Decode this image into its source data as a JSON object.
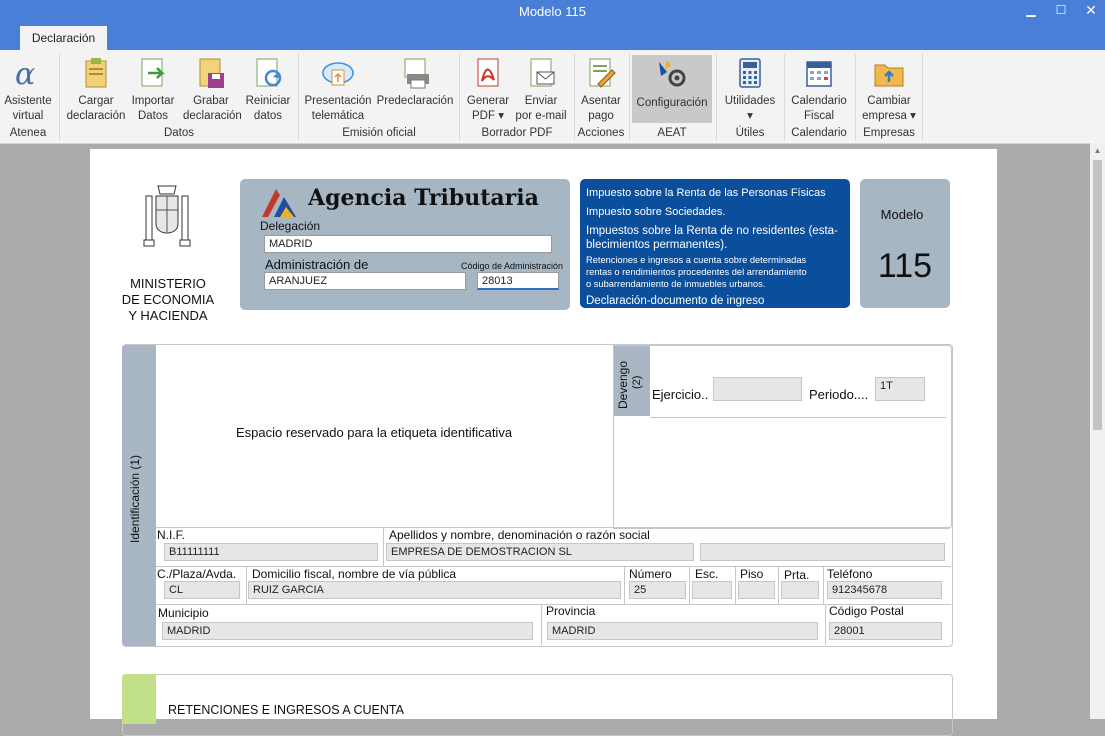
{
  "window": {
    "title": "Modelo 115",
    "min_icon": "minimize-icon",
    "max_icon": "maximize-icon",
    "close_icon": "close-icon"
  },
  "ribbon": {
    "tab": "Declaración",
    "buttons": [
      {
        "id": "asistente",
        "l1": "Asistente",
        "l2": "virtual",
        "icon": "alpha-icon"
      },
      {
        "id": "cargar",
        "l1": "Cargar",
        "l2": "declaración",
        "icon": "clipboard-icon"
      },
      {
        "id": "importar",
        "l1": "Importar",
        "l2": "Datos",
        "icon": "import-icon"
      },
      {
        "id": "grabar",
        "l1": "Grabar",
        "l2": "declaración",
        "icon": "save-icon"
      },
      {
        "id": "reiniciar",
        "l1": "Reiniciar",
        "l2": "datos",
        "icon": "refresh-icon"
      },
      {
        "id": "presentacion",
        "l1": "Presentación",
        "l2": "telemática",
        "icon": "cloud-upload-icon"
      },
      {
        "id": "prede",
        "l1": "Predeclaración",
        "l2": "",
        "icon": "printer-icon"
      },
      {
        "id": "pdf",
        "l1": "Generar",
        "l2": "PDF ▾",
        "icon": "pdf-icon"
      },
      {
        "id": "email",
        "l1": "Enviar",
        "l2": "por e-mail",
        "icon": "email-icon"
      },
      {
        "id": "asentar",
        "l1": "Asentar",
        "l2": "pago",
        "icon": "pencil-doc-icon"
      },
      {
        "id": "config",
        "l1": "Configuración",
        "l2": "",
        "icon": "gear-icon"
      },
      {
        "id": "utiles",
        "l1": "Utilidades",
        "l2": "▾",
        "icon": "calculator-icon"
      },
      {
        "id": "calendario",
        "l1": "Calendario",
        "l2": "Fiscal",
        "icon": "calendar-icon"
      },
      {
        "id": "empresa",
        "l1": "Cambiar",
        "l2": "empresa ▾",
        "icon": "folder-icon"
      }
    ],
    "groups": [
      "Atenea",
      "Datos",
      "Emisión oficial",
      "Borrador PDF",
      "Acciones",
      "AEAT",
      "Útiles",
      "Calendario",
      "Empresas"
    ]
  },
  "header": {
    "ministry": [
      "MINISTERIO",
      "DE ECONOMIA",
      "Y HACIENDA"
    ],
    "agency": "Agencia Tributaria",
    "delegacion_label": "Delegación",
    "delegacion_value": "MADRID",
    "administracion_label": "Administración de",
    "administracion_value": "ARANJUEZ",
    "codigo_label": "Código de Administración",
    "codigo_value": "28013",
    "taxes": [
      "Impuesto sobre la Renta de las Personas Físicas",
      "Impuesto sobre Sociedades.",
      "Impuestos sobre la Renta de no residentes (esta-",
      "blecimientos permanentes).",
      "Retenciones e ingresos a cuenta sobre determinadas",
      "rentas o rendimientos procedentes del arrendamiento",
      "o subarrendamiento de inmuebles urbanos.",
      "Declaración-documento de ingreso"
    ],
    "modelo_label": "Modelo",
    "modelo_value": "115"
  },
  "ident": {
    "side_label": "Identificación (1)",
    "reserved": "Espacio reservado para la etiqueta identificativa",
    "devengo_label": "Devengo",
    "devengo_num": "(2)",
    "ejercicio_label": "Ejercicio..",
    "ejercicio_value": "",
    "periodo_label": "Periodo....",
    "periodo_value": "1T",
    "nif_label": "N.I.F.",
    "nif_value": "B11111111",
    "nombre_label": "Apellidos y nombre, denominación o razón social",
    "nombre_value": "EMPRESA DE DEMOSTRACION SL",
    "via_label": "C./Plaza/Avda.",
    "via_value": "CL",
    "domicilio_label": "Domicilio fiscal, nombre de vía pública",
    "domicilio_value": "RUIZ GARCIA",
    "numero_label": "Número",
    "numero_value": "25",
    "esc_label": "Esc.",
    "piso_label": "Piso",
    "prta_label": "Prta.",
    "telefono_label": "Teléfono",
    "telefono_value": "912345678",
    "municipio_label": "Municipio",
    "municipio_value": "MADRID",
    "provincia_label": "Provincia",
    "provincia_value": "MADRID",
    "cp_label": "Código Postal",
    "cp_value": "28001"
  },
  "section2": {
    "title": "RETENCIONES E INGRESOS A CUENTA"
  },
  "colors": {
    "titlebar": "#4a7fd8",
    "agency_panel": "#a7b6c3",
    "tax_panel": "#0b4f9c",
    "side_green": "#c2e08a"
  }
}
